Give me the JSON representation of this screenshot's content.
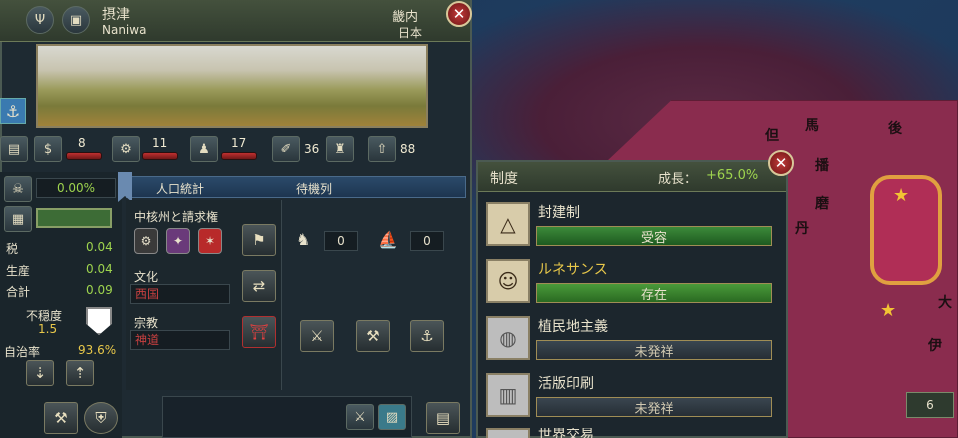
{
  "province": {
    "name_jp": "摂津",
    "name_en": "Naniwa",
    "region": "畿内",
    "owner": "日本"
  },
  "development": {
    "tax": "8",
    "production": "11",
    "manpower": "17",
    "trade_goods_count": "36",
    "unknown_count": "88"
  },
  "stats": {
    "prosperity": "0.00%",
    "tax_label": "税",
    "tax_value": "0.04",
    "production_label": "生産",
    "production_value": "0.04",
    "total_label": "合計",
    "total_value": "0.09",
    "unrest_label": "不穏度",
    "unrest_value": "1.5",
    "autonomy_label": "自治率",
    "autonomy_value": "93.6%"
  },
  "tabs": {
    "population": "人口統計",
    "queue": "待機列"
  },
  "sections": {
    "cores_label": "中核州と請求権",
    "culture_label": "文化",
    "culture_value": "西国",
    "religion_label": "宗教",
    "religion_value": "神道"
  },
  "queue": {
    "army_count": "0",
    "navy_count": "0"
  },
  "institutions": {
    "title": "制度",
    "growth_label": "成長：",
    "growth_value": "+65.0%",
    "items": [
      {
        "name": "封建制",
        "status": "受容"
      },
      {
        "name": "ルネサンス",
        "status": "存在"
      },
      {
        "name": "植民地主義",
        "status": "未発祥"
      },
      {
        "name": "活版印刷",
        "status": "未発祥"
      },
      {
        "name": "世界交易"
      }
    ]
  },
  "map": {
    "labels": [
      "丹",
      "但",
      "馬",
      "後",
      "播",
      "磨",
      "大",
      "伊"
    ],
    "army_count": "6"
  },
  "icons": [
    "close-icon",
    "book-icon",
    "shield-icon"
  ]
}
